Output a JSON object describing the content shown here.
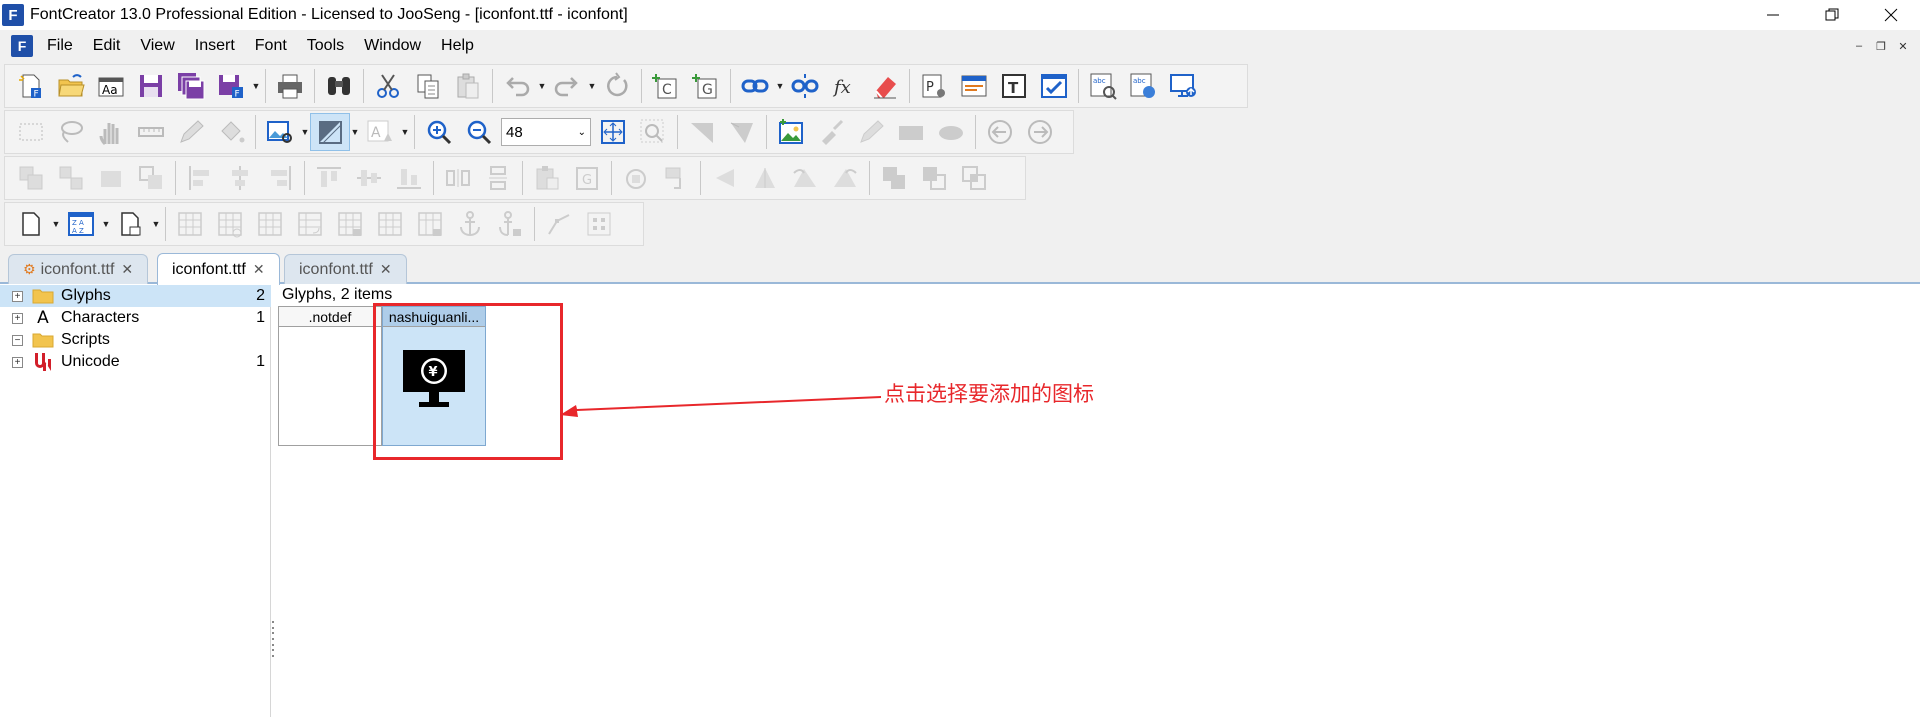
{
  "window": {
    "title": "FontCreator 13.0 Professional Edition - Licensed to JooSeng - [iconfont.ttf - iconfont]",
    "app_icon_glyph": "F"
  },
  "menu": {
    "items": [
      "File",
      "Edit",
      "View",
      "Insert",
      "Font",
      "Tools",
      "Window",
      "Help"
    ]
  },
  "toolbar": {
    "zoom_value": "48"
  },
  "tabs": [
    {
      "label": "iconfont.ttf",
      "modified": true
    },
    {
      "label": "iconfont.ttf",
      "active": true
    },
    {
      "label": "iconfont.ttf"
    }
  ],
  "tree": {
    "items": [
      {
        "label": "Glyphs",
        "count": "2",
        "icon": "folder-icon",
        "selected": true
      },
      {
        "label": "Characters",
        "count": "1",
        "icon": "letter-a-icon"
      },
      {
        "label": "Scripts",
        "count": "",
        "icon": "folder-icon"
      },
      {
        "label": "Unicode",
        "count": "1",
        "icon": "unicode-logo-icon"
      }
    ]
  },
  "main": {
    "header": "Glyphs, 2 items",
    "glyphs": [
      {
        "name": ".notdef"
      },
      {
        "name": "nashuiguanli..."
      }
    ]
  },
  "annotation": {
    "text": "点击选择要添加的图标",
    "color": "#e8272b"
  },
  "colors": {
    "selection": "#cce4f7",
    "accent": "#1f4fa8"
  }
}
